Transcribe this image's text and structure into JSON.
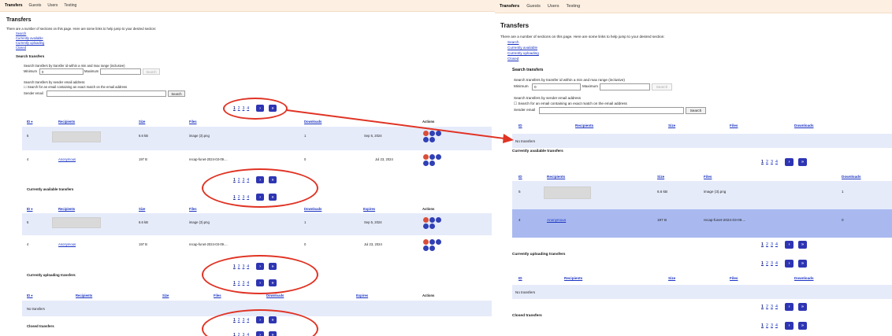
{
  "tabs": [
    "Transfers",
    "Guests",
    "Users",
    "Testing"
  ],
  "page_title": "Transfers",
  "intro": "There are a number of sections on this page. Here are some links to help jump to your desired section:",
  "jump_links": [
    "Search",
    "Currently available",
    "Currently uploading",
    "Closed"
  ],
  "search": {
    "heading": "Search transfers",
    "id_text": "Search transfers by transfer id within a min and max range (inclusive)",
    "min_label": "Minimum",
    "min_value": "0",
    "max_label": "Maximum",
    "search_label": "Search",
    "email_text": "Search transfers by sender email address",
    "contains_label": "Search for an email containing an exact match on the email address",
    "email_label": "Sender email"
  },
  "pagination": {
    "pages": [
      "1",
      "2",
      "3",
      "4"
    ],
    "next": "›",
    "last": "»"
  },
  "columns": {
    "id": "ID",
    "id_sorted": "ID ▾",
    "recipients": "Recipients",
    "size": "Size",
    "files": "Files",
    "downloads": "Downloads",
    "expires": "Expires",
    "actions": "Actions"
  },
  "sections": {
    "available": "Currently available transfers",
    "uploading": "Currently uploading transfers",
    "closed": "Closed transfers"
  },
  "no_transfers": "No transfers",
  "rows": [
    {
      "id": "5",
      "recipient": "",
      "size": "6.6 kB",
      "files": "image (3).png",
      "downloads": "1",
      "expires": "Sep 5, 2024"
    },
    {
      "id": "4",
      "recipient": "Anonymous",
      "size": "197 B",
      "files": "recap-funet-2024-03-09....",
      "downloads": "0",
      "expires": "Jul 23, 2024"
    }
  ],
  "accent_colors": {
    "tab_bar": "#fdf0e2",
    "row_band": "#e6ebfa",
    "row_selected": "#a9b9f0",
    "button": "#2e35b3",
    "annotation": "#e03324"
  }
}
